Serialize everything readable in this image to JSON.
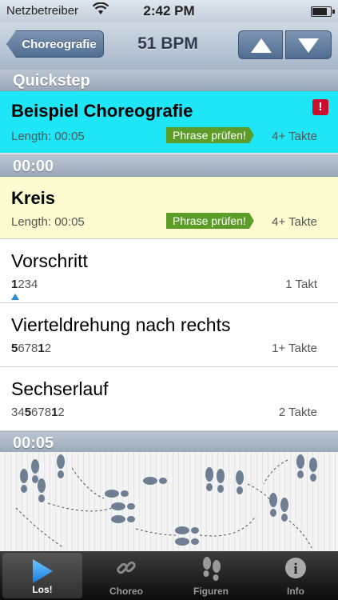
{
  "status_bar": {
    "carrier": "Netzbetreiber",
    "time": "2:42 PM"
  },
  "nav": {
    "back_label": "Choreografie",
    "title": "51 BPM"
  },
  "sections": {
    "top": "Quickstep",
    "mid": "00:00",
    "bottom": "00:05"
  },
  "choreo_row": {
    "title": "Beispiel Choreografie",
    "length": "Length: 00:05",
    "badge": "Phrase prüfen!",
    "count": "4+ Takte",
    "alert": "!",
    "highlight_color": "#1ee6f6"
  },
  "figures": [
    {
      "title": "Kreis",
      "sub": "Length: 00:05",
      "badge": "Phrase prüfen!",
      "count": "4+ Takte",
      "highlight_color": "#fdfcd0"
    },
    {
      "title": "Vorschritt",
      "beat_bold": "1",
      "beat_rest": "234",
      "count": "1 Takt"
    },
    {
      "title": "Vierteldrehung nach rechts",
      "beat_bold": "5",
      "beat_rest": "678",
      "beat_bold2": "1",
      "beat_rest2": "2",
      "count": "1+ Takte"
    },
    {
      "title": "Sechserlauf",
      "beat_pre": "34",
      "beat_bold": "5",
      "beat_rest": "678",
      "beat_bold2": "1",
      "beat_rest2": "2",
      "count": "2 Takte"
    }
  ],
  "tabs": [
    {
      "label": "Los!",
      "icon": "play-icon",
      "active": true
    },
    {
      "label": "Choreo",
      "icon": "link-icon",
      "active": false
    },
    {
      "label": "Figuren",
      "icon": "footprints-icon",
      "active": false
    },
    {
      "label": "Info",
      "icon": "info-icon",
      "active": false
    }
  ]
}
